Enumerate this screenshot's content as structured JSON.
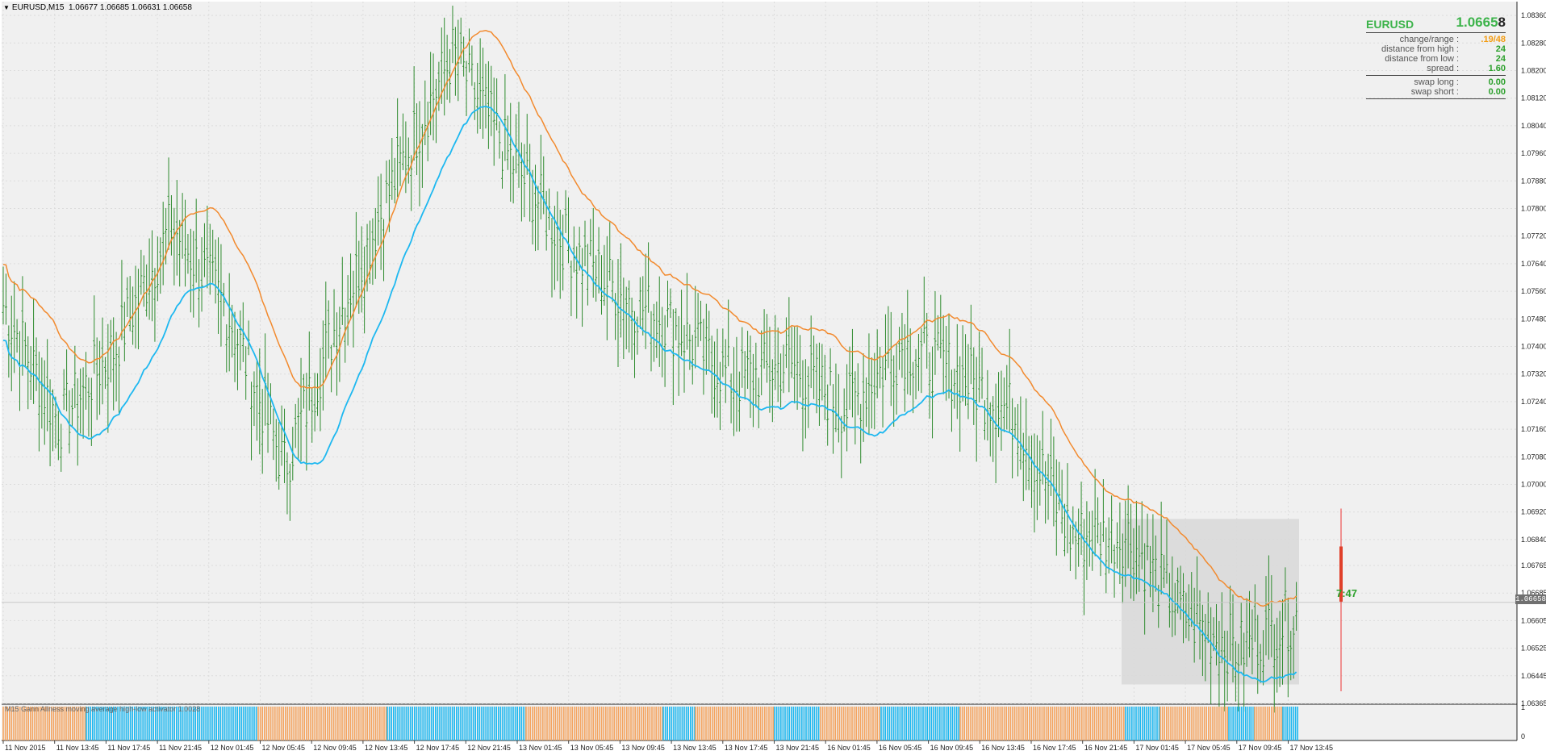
{
  "header": {
    "symbol_label": "EURUSD,M15",
    "ohlc": "1.06677 1.06685 1.06631 1.06658"
  },
  "info_panel": {
    "symbol": "EURUSD",
    "price_main": "1.0665",
    "price_last_digit": "8",
    "rows": [
      {
        "label": "change/range :",
        "value": ".19/48",
        "color": "orange"
      },
      {
        "label": "distance from high :",
        "value": "24",
        "color": "green"
      },
      {
        "label": "distance from low :",
        "value": "24",
        "color": "green"
      },
      {
        "label": "spread :",
        "value": "1.60",
        "color": "green"
      }
    ],
    "swap_rows": [
      {
        "label": "swap long :",
        "value": "0.00"
      },
      {
        "label": "swap short :",
        "value": "0.00"
      }
    ]
  },
  "countdown": "7:47",
  "current_price_tag": "1.06658",
  "indicator_label": "M15 Gann Allness moving average high-low activator 1.0028",
  "price_axis": {
    "labels": [
      "1.08360",
      "1.08280",
      "1.08200",
      "1.08120",
      "1.08040",
      "1.07960",
      "1.07880",
      "1.07800",
      "1.07720",
      "1.07640",
      "1.07560",
      "1.07480",
      "1.07400",
      "1.07320",
      "1.07240",
      "1.07160",
      "1.07080",
      "1.07000",
      "1.06920",
      "1.06840",
      "1.06765",
      "1.06685",
      "1.06605",
      "1.06525",
      "1.06445",
      "1.06365"
    ],
    "indicator_labels": [
      "1",
      "0"
    ]
  },
  "time_axis": {
    "labels": [
      "11 Nov 2015",
      "11 Nov 13:45",
      "11 Nov 17:45",
      "11 Nov 21:45",
      "12 Nov 01:45",
      "12 Nov 05:45",
      "12 Nov 09:45",
      "12 Nov 13:45",
      "12 Nov 17:45",
      "12 Nov 21:45",
      "13 Nov 01:45",
      "13 Nov 05:45",
      "13 Nov 09:45",
      "13 Nov 13:45",
      "13 Nov 17:45",
      "13 Nov 21:45",
      "16 Nov 01:45",
      "16 Nov 05:45",
      "16 Nov 09:45",
      "16 Nov 13:45",
      "16 Nov 17:45",
      "16 Nov 21:45",
      "17 Nov 01:45",
      "17 Nov 05:45",
      "17 Nov 09:45",
      "17 Nov 13:45"
    ]
  },
  "colors": {
    "bars": "#2e8b2e",
    "ma_orange": "#f28a2e",
    "ma_blue": "#1eb8f0",
    "bg": "#f0f0f0",
    "grid": "#dcdcdc",
    "hist_orange": "#f4a460",
    "hist_blue": "#1eb8f0"
  },
  "chart_data": {
    "type": "line",
    "title": "EURUSD,M15",
    "ylim": [
      1.06365,
      1.084
    ],
    "x_start": "11 Nov 2015",
    "x_end": "17 Nov 13:45",
    "anchors": [
      {
        "t": "11 Nov 2015",
        "price": 1.0752
      },
      {
        "t": "11 Nov 13:45",
        "price": 1.0718
      },
      {
        "t": "11 Nov 21:45",
        "price": 1.074
      },
      {
        "t": "12 Nov 01:45",
        "price": 1.0775
      },
      {
        "t": "12 Nov 05:45",
        "price": 1.075
      },
      {
        "t": "12 Nov 09:45",
        "price": 1.0705
      },
      {
        "t": "12 Nov 13:45",
        "price": 1.075
      },
      {
        "t": "12 Nov 17:45",
        "price": 1.079
      },
      {
        "t": "12 Nov 21:45",
        "price": 1.0825
      },
      {
        "t": "13 Nov 01:45",
        "price": 1.0795
      },
      {
        "t": "13 Nov 05:45",
        "price": 1.077
      },
      {
        "t": "13 Nov 09:45",
        "price": 1.0755
      },
      {
        "t": "13 Nov 13:45",
        "price": 1.0745
      },
      {
        "t": "13 Nov 17:45",
        "price": 1.073
      },
      {
        "t": "13 Nov 21:45",
        "price": 1.0735
      },
      {
        "t": "16 Nov 01:45",
        "price": 1.0722
      },
      {
        "t": "16 Nov 05:45",
        "price": 1.074
      },
      {
        "t": "16 Nov 09:45",
        "price": 1.0732
      },
      {
        "t": "16 Nov 13:45",
        "price": 1.072
      },
      {
        "t": "16 Nov 17:45",
        "price": 1.0685
      },
      {
        "t": "16 Nov 21:45",
        "price": 1.0685
      },
      {
        "t": "17 Nov 01:45",
        "price": 1.0662
      },
      {
        "t": "17 Nov 05:45",
        "price": 1.0652
      },
      {
        "t": "17 Nov 09:45",
        "price": 1.0662
      }
    ],
    "series": [
      {
        "name": "price",
        "values": [
          1.0752,
          1.0718,
          1.074,
          1.0775,
          1.075,
          1.0705,
          1.075,
          1.079,
          1.0825,
          1.0795,
          1.077,
          1.0755,
          1.0745,
          1.073,
          1.0735,
          1.0722,
          1.074,
          1.0732,
          1.072,
          1.0685,
          1.0685,
          1.0662,
          1.0652,
          1.0662
        ]
      }
    ],
    "current_price": 1.06658
  }
}
